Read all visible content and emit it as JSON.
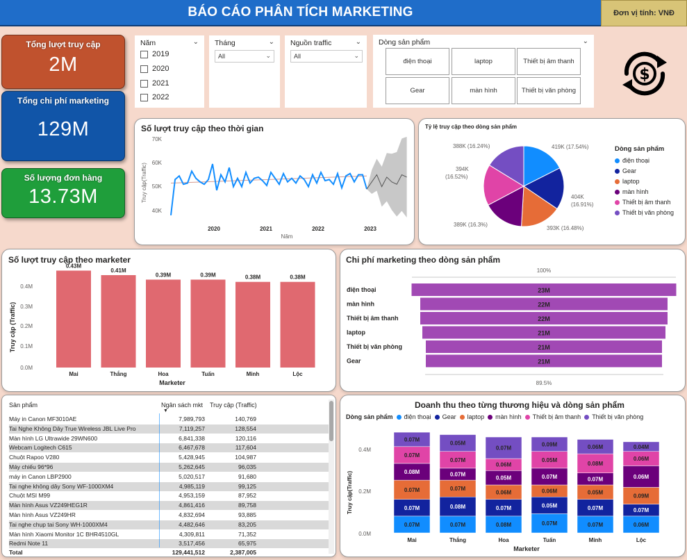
{
  "header": {
    "title": "BÁO CÁO PHÂN TÍCH MARKETING",
    "unit": "Đơn vị tính: VNĐ"
  },
  "kpis": [
    {
      "label": "Tổng lượt truy cập",
      "value": "2M",
      "color": "#c0522e"
    },
    {
      "label": "Tổng chi phí marketing",
      "value": "129M",
      "color": "#1155a8"
    },
    {
      "label": "Số lượng đơn hàng",
      "value": "13.73M",
      "color": "#1f9e3b"
    }
  ],
  "slicers": {
    "year": {
      "title": "Năm",
      "options": [
        "2019",
        "2020",
        "2021",
        "2022"
      ]
    },
    "month": {
      "title": "Tháng",
      "value": "All"
    },
    "traffic": {
      "title": "Nguồn traffic",
      "value": "All"
    },
    "product_line": {
      "title": "Dòng sản phẩm",
      "tiles": [
        "điện thoại",
        "laptop",
        "Thiết bị âm thanh",
        "Gear",
        "màn hình",
        "Thiết bị văn phòng"
      ]
    }
  },
  "icons": {
    "money": "dollar-cycle-icon"
  },
  "colors": {
    "line": "#118dff",
    "forecast": "#555555",
    "band": "#c8c8c8",
    "trend": "#d59a8f",
    "bar_red": "#e06970",
    "funnel": "#a149b4",
    "cat_dien_thoai": "#118dff",
    "cat_gear": "#12239e",
    "cat_laptop": "#e66c37",
    "cat_man_hinh": "#6b007b",
    "cat_am_thanh": "#e044a7",
    "cat_van_phong": "#744ec2"
  },
  "line_chart": {
    "title": "Số lượt truy cập theo thời gian",
    "ylabel": "Truy cập(Traffic)",
    "xlabel": "Năm",
    "yticks": [
      "70K",
      "60K",
      "50K",
      "40K"
    ],
    "xticks": [
      "2020",
      "2021",
      "2022",
      "2023"
    ]
  },
  "pie_chart": {
    "title": "Tỷ lệ truy cập theo dòng sản phẩm",
    "legend_title": "Dòng sản phẩm",
    "labels": [
      "419K (17.54%)",
      "404K (16.91%)",
      "393K (16.48%)",
      "389K (16.3%)",
      "394K (16.52%)",
      "388K (16.24%)"
    ],
    "legend": [
      "điện thoại",
      "Gear",
      "laptop",
      "màn hình",
      "Thiết bị âm thanh",
      "Thiết bị văn phòng"
    ]
  },
  "bar_chart": {
    "title": "Số lượt truy cập theo marketer",
    "ylabel": "Truy cập (Traffic)",
    "xlabel": "Marketer",
    "yticks": [
      "0.4M",
      "0.3M",
      "0.2M",
      "0.1M",
      "0.0M"
    ],
    "labels": [
      "0.43M",
      "0.41M",
      "0.39M",
      "0.39M",
      "0.38M",
      "0.38M"
    ]
  },
  "funnel_chart": {
    "title": "Chi phí marketing theo dòng sản phẩm",
    "top_label": "100%",
    "bottom_label": "89.5%",
    "rows": [
      {
        "name": "điện thoại",
        "label": "23M"
      },
      {
        "name": "màn hình",
        "label": "22M"
      },
      {
        "name": "Thiết bị âm thanh",
        "label": "22M"
      },
      {
        "name": "laptop",
        "label": "21M"
      },
      {
        "name": "Thiết bị văn phòng",
        "label": "21M"
      },
      {
        "name": "Gear",
        "label": "21M"
      }
    ]
  },
  "table": {
    "headers": [
      "Sản phẩm",
      "Ngân sách mkt",
      "Truy cập (Traffic)"
    ],
    "rows": [
      [
        "Máy in Canon MF3010AE",
        "7,989,793",
        "140,769"
      ],
      [
        "Tai Nghe Không Dây True Wireless JBL Live Pro",
        "7,119,257",
        "128,554"
      ],
      [
        "Màn hình LG Ultrawide 29WN600",
        "6,841,338",
        "120,116"
      ],
      [
        "Webcam Logitech C615",
        "6,467,678",
        "117,604"
      ],
      [
        "Chuột Rapoo V280",
        "5,428,945",
        "104,987"
      ],
      [
        "Máy chiếu 96*96",
        "5,262,645",
        "96,035"
      ],
      [
        "máy in Canon LBP2900",
        "5,020,517",
        "91,680"
      ],
      [
        "Tai nghe không dây Sony WF-1000XM4",
        "4,985,119",
        "99,125"
      ],
      [
        "Chuột MSI M99",
        "4,953,159",
        "87,952"
      ],
      [
        "Màn hình Asus VZ249HEG1R",
        "4,861,416",
        "89,758"
      ],
      [
        "Màn hình Asus VZ249HR",
        "4,832,694",
        "93,885"
      ],
      [
        "Tai nghe chụp tai Sony WH-1000XM4",
        "4,482,646",
        "83,205"
      ],
      [
        "Màn hình Xiaomi Monitor 1C BHR4510GL",
        "4,309,811",
        "71,352"
      ],
      [
        "Redmi Note 11",
        "3,517,456",
        "65,975"
      ]
    ],
    "total": [
      "Total",
      "129,441,512",
      "2,387,005"
    ]
  },
  "stacked_chart": {
    "title": "Doanh thu theo từng thương hiệu và dòng sản phẩm",
    "legend_title": "Dòng sản phẩm",
    "ylabel": "Truy cập(Traffic)",
    "xlabel": "Marketer",
    "yticks": [
      "0.4M",
      "0.2M",
      "0.0M"
    ]
  },
  "chart_data": [
    {
      "type": "line",
      "title": "Số lượt truy cập theo thời gian",
      "xlabel": "Năm",
      "ylabel": "Truy cập(Traffic)",
      "ylim": [
        40000,
        70000
      ],
      "x_range": [
        "2019",
        "2023"
      ],
      "series": [
        {
          "values": [
            38000,
            53000,
            54500,
            51000,
            51500,
            56500,
            53500,
            52000,
            51000,
            53000,
            59500,
            48500,
            55000,
            52000,
            58000,
            50000,
            53500,
            50000,
            56000,
            51500,
            53500,
            54000,
            52500,
            50500,
            56000,
            53500,
            51000,
            55500,
            52000,
            53500,
            51500,
            54500,
            53000,
            50000,
            55000,
            51500,
            56000,
            52500,
            53000,
            51000,
            55500,
            49500,
            54500,
            55500,
            52000,
            55000,
            55000,
            49000
          ]
        }
      ],
      "forecast": [
        52000,
        55000,
        50000,
        54000,
        52000,
        51000,
        55000,
        54000
      ],
      "trend": [
        51500,
        54500
      ]
    },
    {
      "type": "pie",
      "title": "Tỷ lệ truy cập theo dòng sản phẩm",
      "categories": [
        "điện thoại",
        "Gear",
        "laptop",
        "màn hình",
        "Thiết bị âm thanh",
        "Thiết bị văn phòng"
      ],
      "values": [
        419,
        404,
        393,
        389,
        394,
        388
      ],
      "percents": [
        17.54,
        16.91,
        16.48,
        16.3,
        16.52,
        16.24
      ]
    },
    {
      "type": "bar",
      "title": "Số lượt truy cập theo marketer",
      "categories": [
        "Mai",
        "Thắng",
        "Hoa",
        "Tuấn",
        "Minh",
        "Lộc"
      ],
      "values": [
        0.43,
        0.41,
        0.39,
        0.39,
        0.38,
        0.38
      ],
      "ylabel": "Truy cập (Traffic)",
      "xlabel": "Marketer",
      "ylim": [
        0,
        0.45
      ]
    },
    {
      "type": "bar",
      "title": "Chi phí marketing theo dòng sản phẩm",
      "categories": [
        "điện thoại",
        "màn hình",
        "Thiết bị âm thanh",
        "laptop",
        "Thiết bị văn phòng",
        "Gear"
      ],
      "values": [
        23,
        22,
        22,
        21,
        21,
        21
      ]
    },
    {
      "type": "bar",
      "title": "Doanh thu theo từng thương hiệu và dòng sản phẩm",
      "categories": [
        "Mai",
        "Thắng",
        "Hoa",
        "Tuấn",
        "Minh",
        "Lộc"
      ],
      "xlabel": "Marketer",
      "ylabel": "Truy cập(Traffic)",
      "ylim": [
        0,
        0.45
      ],
      "series": [
        {
          "name": "điện thoại",
          "values": [
            0.07,
            0.07,
            0.07,
            0.08,
            0.07,
            0.07
          ]
        },
        {
          "name": "Gear",
          "values": [
            0.07,
            0.08,
            0.07,
            0.07,
            0.07,
            0.05
          ]
        },
        {
          "name": "laptop",
          "values": [
            0.08,
            0.07,
            0.06,
            0.05,
            0.06,
            0.07
          ]
        },
        {
          "name": "màn hình",
          "values": [
            0.07,
            0.05,
            0.06,
            0.07,
            0.05,
            0.09
          ]
        },
        {
          "name": "Thiết bị âm thanh",
          "values": [
            0.07,
            0.07,
            0.05,
            0.07,
            0.08,
            0.06
          ]
        },
        {
          "name": "Thiết bị văn phòng",
          "values": [
            0.06,
            0.07,
            0.09,
            0.06,
            0.06,
            0.04
          ]
        }
      ],
      "labels": [
        [
          "0.07M",
          "0.07M",
          "0.08M",
          "0.07M",
          "0.07M",
          "0.06M"
        ],
        [
          "0.07M",
          "0.08M",
          "0.07M",
          "0.05M",
          "0.07M",
          "0.07M"
        ],
        [
          "0.07M",
          "0.07M",
          "0.06M",
          "0.06M",
          "0.05M",
          "0.09M"
        ],
        [
          "0.08M",
          "0.07M",
          "0.05M",
          "0.07M",
          "0.07M",
          "0.06M"
        ],
        [
          "0.07M",
          "0.07M",
          "0.06M",
          "0.05M",
          "0.08M",
          "0.06M"
        ],
        [
          "0.07M",
          "0.05M",
          "0.07M",
          "0.09M",
          "0.06M",
          "0.04M"
        ]
      ]
    }
  ]
}
